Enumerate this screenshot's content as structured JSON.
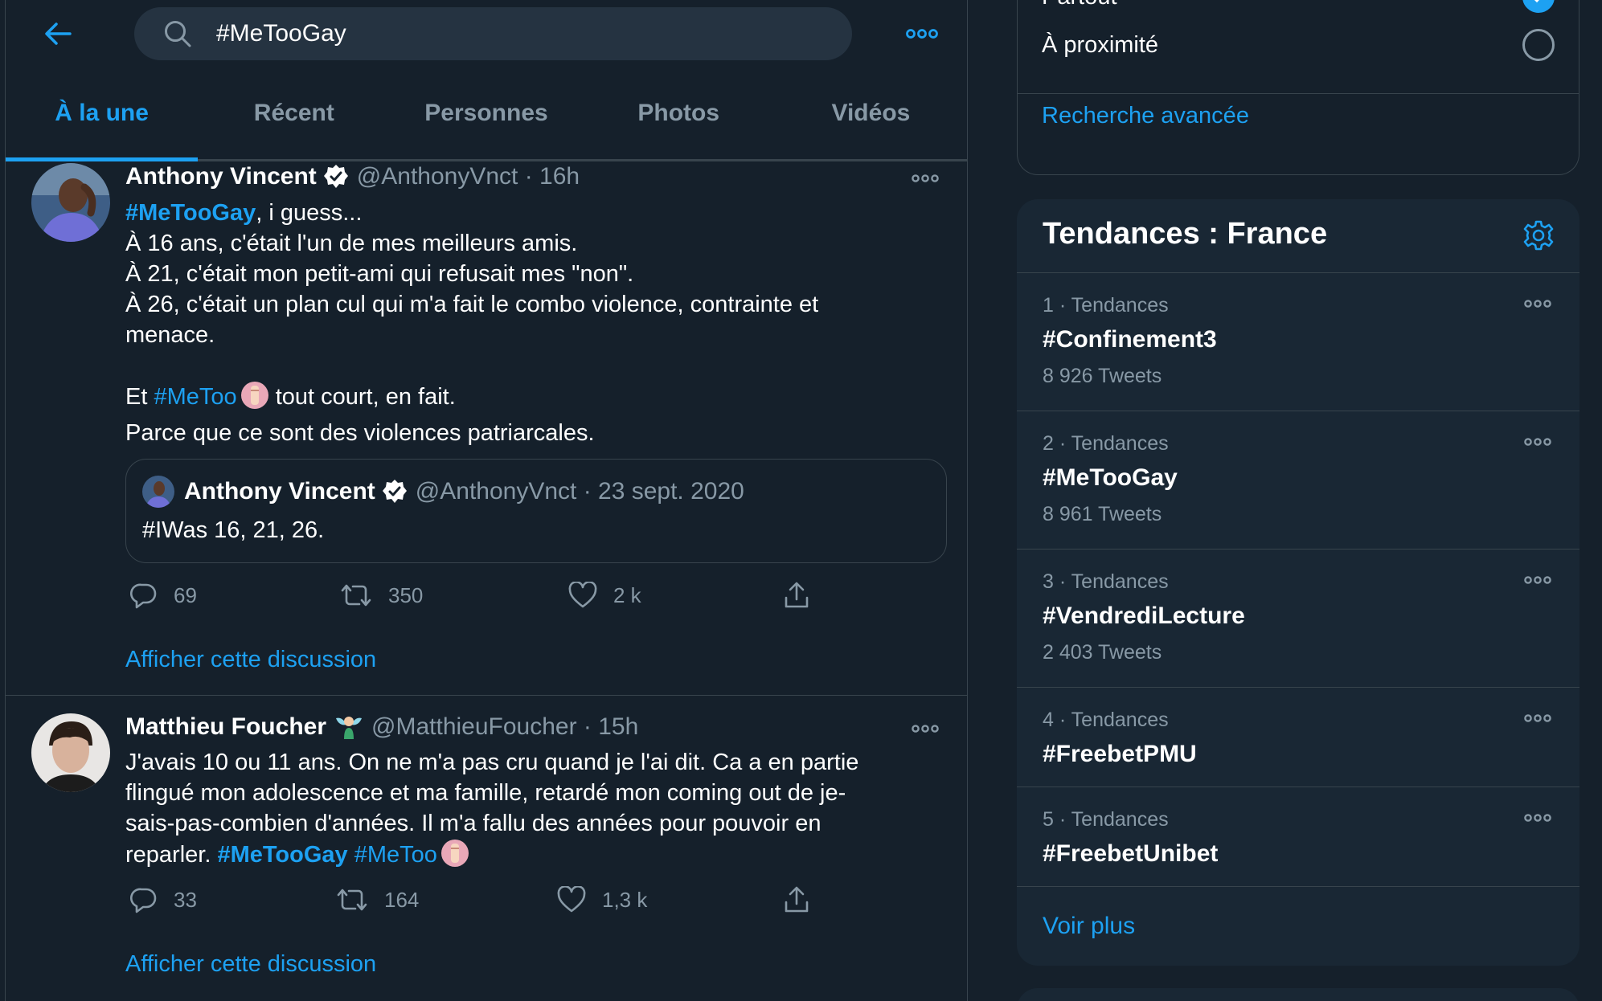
{
  "search": {
    "query": "#MeTooGay"
  },
  "tabs": [
    {
      "label": "À la une"
    },
    {
      "label": "Récent"
    },
    {
      "label": "Personnes"
    },
    {
      "label": "Photos"
    },
    {
      "label": "Vidéos"
    }
  ],
  "tweets": [
    {
      "name": "Anthony Vincent",
      "handle": "@AnthonyVnct · 16h",
      "body": {
        "line1_tag": "#MeTooGay",
        "line1_rest": ", i guess...",
        "line2": "À 16 ans, c'était l'un de mes meilleurs amis.",
        "line3": "À 21, c'était mon petit-ami qui refusait mes \"non\".",
        "line4": "À 26, c'était un plan cul qui m'a fait le combo violence, contrainte et",
        "line5": "menace.",
        "line6_pre": "Et ",
        "line6_tag": "#MeToo",
        "line6_rest": " tout court, en fait.",
        "line7": "Parce que ce sont des violences patriarcales."
      },
      "quote": {
        "name": "Anthony Vincent",
        "handle": "@AnthonyVnct · 23 sept. 2020",
        "text": "#IWas 16, 21, 26."
      },
      "replies": "69",
      "retweets": "350",
      "likes": "2 k",
      "discussion": "Afficher cette discussion"
    },
    {
      "name": "Matthieu Foucher",
      "handle": "@MatthieuFoucher · 15h",
      "body": {
        "line1": "J'avais 10 ou 11 ans. On ne m'a pas cru quand je l'ai dit. Ca a en partie",
        "line2": "flingué mon adolescence et ma famille, retardé mon coming out de je-",
        "line3": "sais-pas-combien d'années. Il m'a fallu des années pour pouvoir en",
        "line4_pre": "reparler. ",
        "line4_tag1": "#MeTooGay",
        "line4_tag2": "#MeToo"
      },
      "replies": "33",
      "retweets": "164",
      "likes": "1,3 k",
      "discussion": "Afficher cette discussion"
    }
  ],
  "location": {
    "option1": "Partout",
    "option2": "À proximité",
    "advanced": "Recherche avancée"
  },
  "trends": {
    "title": "Tendances : France",
    "items": [
      {
        "meta": "1 · Tendances",
        "tag": "#Confinement3",
        "count": "8 926 Tweets"
      },
      {
        "meta": "2 · Tendances",
        "tag": "#MeTooGay",
        "count": "8 961 Tweets"
      },
      {
        "meta": "3 · Tendances",
        "tag": "#VendrediLecture",
        "count": "2 403 Tweets"
      },
      {
        "meta": "4 · Tendances",
        "tag": "#FreebetPMU",
        "count": ""
      },
      {
        "meta": "5 · Tendances",
        "tag": "#FreebetUnibet",
        "count": ""
      }
    ],
    "show_more": "Voir plus"
  },
  "colors": {
    "background": "#15202b",
    "card": "#192734",
    "accent": "#1da1f2",
    "muted": "#8899a6",
    "border": "#38444d"
  },
  "icons": [
    "back-arrow-icon",
    "search-icon",
    "more-icon",
    "verified-icon",
    "reply-icon",
    "retweet-icon",
    "like-icon",
    "share-icon",
    "gear-icon",
    "check-icon",
    "raised-fist-emoji",
    "man-fairy-emoji"
  ]
}
